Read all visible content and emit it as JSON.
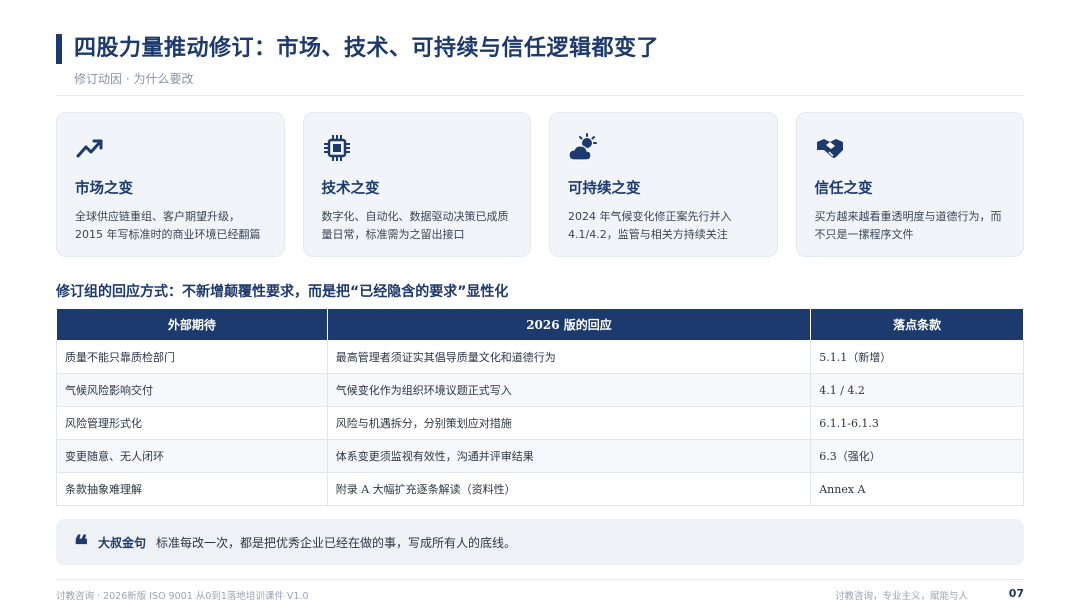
{
  "header": {
    "title": "四股力量推动修订：市场、技术、可持续与信任逻辑都变了",
    "subtitle": "修订动因 · 为什么要改"
  },
  "cards": [
    {
      "icon": "trending-up-icon",
      "title": "市场之变",
      "desc": "全球供应链重组、客户期望升级，2015 年写标准时的商业环境已经翻篇"
    },
    {
      "icon": "chip-icon",
      "title": "技术之变",
      "desc": "数字化、自动化、数据驱动决策已成质量日常，标准需为之留出接口"
    },
    {
      "icon": "cloud-sun-icon",
      "title": "可持续之变",
      "desc": "2024 年气候变化修正案先行并入 4.1/4.2，监管与相关方持续关注"
    },
    {
      "icon": "handshake-icon",
      "title": "信任之变",
      "desc": "买方越来越看重透明度与道德行为，而不只是一摞程序文件"
    }
  ],
  "section_title": "修订组的回应方式：不新增颠覆性要求，而是把“已经隐含的要求”显性化",
  "table": {
    "headers": [
      "外部期待",
      "2026 版的回应",
      "落点条款"
    ],
    "rows": [
      [
        "质量不能只靠质检部门",
        "最高管理者须证实其倡导质量文化和道德行为",
        "5.1.1（新增）"
      ],
      [
        "气候风险影响交付",
        "气候变化作为组织环境议题正式写入",
        "4.1 / 4.2"
      ],
      [
        "风险管理形式化",
        "风险与机遇拆分，分别策划应对措施",
        "6.1.1-6.1.3"
      ],
      [
        "变更随意、无人闭环",
        "体系变更须监视有效性，沟通并评审结果",
        "6.3（强化）"
      ],
      [
        "条款抽象难理解",
        "附录 A 大幅扩充逐条解读（资料性）",
        "Annex A"
      ]
    ]
  },
  "quote": {
    "icon": "quote-icon",
    "label": "大叔金句",
    "text": "标准每改一次，都是把优秀企业已经在做的事，写成所有人的底线。"
  },
  "footer": {
    "left": "讨教咨询 · 2026新版 ISO 9001 从0到1落地培训课件 V1.0",
    "right": "讨教咨询，专业主义，赋能与人",
    "page": "07"
  },
  "colors": {
    "primary": "#1d3a6e",
    "card_bg": "#f1f5fa"
  }
}
